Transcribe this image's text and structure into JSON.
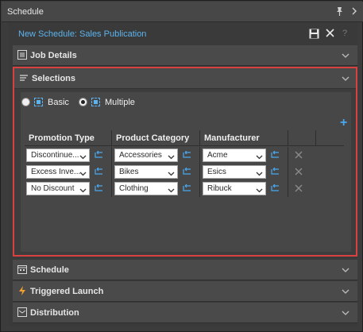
{
  "window": {
    "title": "Schedule"
  },
  "header": {
    "schedule_name": "New Schedule: Sales Publication",
    "help_label": "?"
  },
  "sections": {
    "job_details": "Job Details",
    "selections": "Selections",
    "schedule": "Schedule",
    "triggered_launch": "Triggered Launch",
    "distribution": "Distribution"
  },
  "selections": {
    "mode_basic": "Basic",
    "mode_multiple": "Multiple",
    "selected_mode": "Multiple",
    "add_label": "+",
    "columns": [
      "Promotion Type",
      "Product Category",
      "Manufacturer"
    ],
    "rows": [
      [
        "Discontinue...",
        "Accessories",
        "Acme"
      ],
      [
        "Excess Inve...",
        "Bikes",
        "Esics"
      ],
      [
        "No Discount",
        "Clothing",
        "Ribuck"
      ]
    ]
  },
  "colors": {
    "accent": "#5bb4ef",
    "highlight_border": "#d94040",
    "background": "#3a3a3a"
  }
}
